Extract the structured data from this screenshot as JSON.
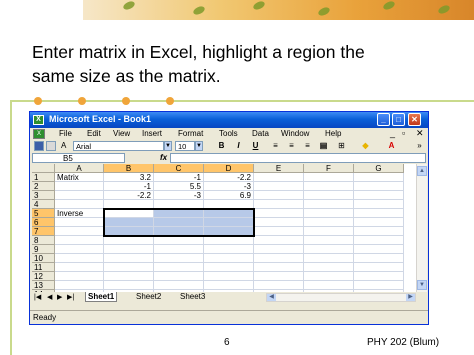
{
  "slide": {
    "heading_line1": "Enter matrix in Excel, highlight a region the",
    "heading_line2": "same size as the matrix.",
    "page_number": "6",
    "footer_right": "PHY 202 (Blum)"
  },
  "excel": {
    "title": "Microsoft Excel - Book1",
    "menu": [
      "File",
      "Edit",
      "View",
      "Insert",
      "Format",
      "Tools",
      "Data",
      "Window",
      "Help"
    ],
    "font_name": "Arial",
    "font_size": "10",
    "format_buttons": [
      "B",
      "I",
      "U"
    ],
    "name_box": "B5",
    "fx_symbol": "fx",
    "columns": [
      "A",
      "B",
      "C",
      "D",
      "E",
      "F",
      "G"
    ],
    "rows": [
      "1",
      "2",
      "3",
      "4",
      "5",
      "6",
      "7",
      "8",
      "9",
      "10",
      "11",
      "12",
      "13",
      "14"
    ],
    "cells": {
      "A1": "Matrix",
      "B1": "3.2",
      "C1": "-1",
      "D1": "-2.2",
      "B2": "-1",
      "C2": "5.5",
      "D2": "-3",
      "B3": "-2.2",
      "C3": "-3",
      "D3": "6.9",
      "A5": "Inverse"
    },
    "sheets": [
      "Sheet1",
      "Sheet2",
      "Sheet3"
    ],
    "status": "Ready"
  },
  "colors": {
    "titlebar": "#0a5fd8",
    "selection_fill": "#b7c9e8",
    "header_highlight": "#ffc56a",
    "accent_orange": "#f0a53a",
    "accent_green": "#c9da8c"
  }
}
